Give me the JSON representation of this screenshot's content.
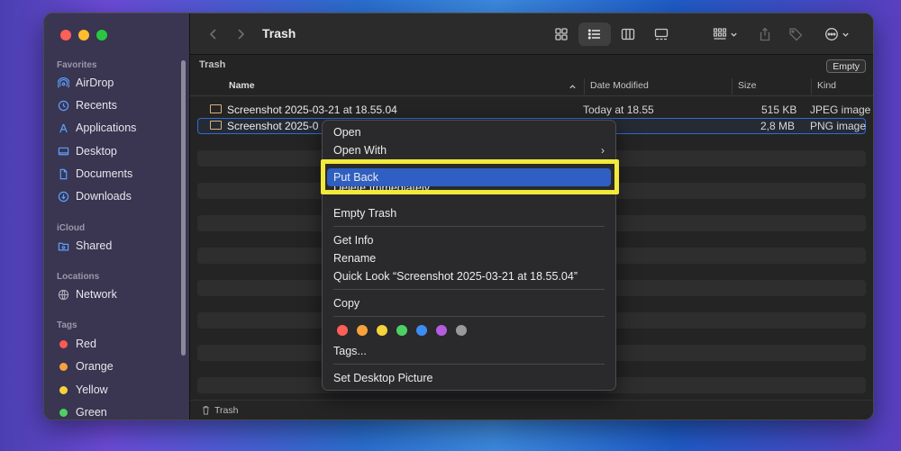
{
  "window": {
    "title": "Trash",
    "path_label": "Trash",
    "empty_button": "Empty",
    "status_label": "Trash"
  },
  "sidebar": {
    "favorites_header": "Favorites",
    "favorites": [
      {
        "label": "AirDrop",
        "icon": "airdrop-icon"
      },
      {
        "label": "Recents",
        "icon": "clock-icon"
      },
      {
        "label": "Applications",
        "icon": "applications-icon"
      },
      {
        "label": "Desktop",
        "icon": "desktop-icon"
      },
      {
        "label": "Documents",
        "icon": "document-icon"
      },
      {
        "label": "Downloads",
        "icon": "download-icon"
      }
    ],
    "icloud_header": "iCloud",
    "icloud": [
      {
        "label": "Shared",
        "icon": "shared-folder-icon"
      }
    ],
    "locations_header": "Locations",
    "locations": [
      {
        "label": "Network",
        "icon": "network-icon"
      }
    ],
    "tags_header": "Tags",
    "tags": [
      {
        "label": "Red",
        "color": "#ff5a52"
      },
      {
        "label": "Orange",
        "color": "#f7a23b"
      },
      {
        "label": "Yellow",
        "color": "#f5d33a"
      },
      {
        "label": "Green",
        "color": "#4cd263"
      }
    ]
  },
  "columns": {
    "name": "Name",
    "date": "Date Modified",
    "size": "Size",
    "kind": "Kind"
  },
  "files": [
    {
      "name": "Screenshot 2025-03-21 at 18.55.04",
      "date": "Today at 18.55",
      "size": "515 KB",
      "kind": "JPEG image"
    },
    {
      "name": "Screenshot 2025-0",
      "date": "",
      "size": "2,8 MB",
      "kind": "PNG image"
    }
  ],
  "context_menu": {
    "open": "Open",
    "open_with": "Open With",
    "put_back": "Put Back",
    "delete_immediately": "Delete Immediately…",
    "empty_trash": "Empty Trash",
    "get_info": "Get Info",
    "rename": "Rename",
    "quick_look": "Quick Look “Screenshot 2025-03-21 at 18.55.04”",
    "copy": "Copy",
    "tag_colors": [
      "#ff5f57",
      "#f7a23b",
      "#f5d33a",
      "#4cd263",
      "#3d8cf5",
      "#b65ddf",
      "#9a9a9a"
    ],
    "tags": "Tags...",
    "set_desktop_picture": "Set Desktop Picture"
  },
  "accent_color": "#2f5fc2",
  "highlight_color": "#f2ea3a"
}
